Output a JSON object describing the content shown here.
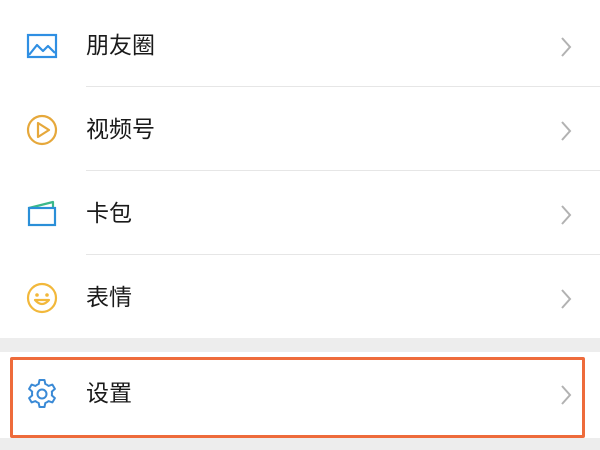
{
  "menu": {
    "items": [
      {
        "label": "朋友圈",
        "icon": "moments-picture-icon"
      },
      {
        "label": "视频号",
        "icon": "channels-play-icon"
      },
      {
        "label": "卡包",
        "icon": "card-wallet-icon"
      },
      {
        "label": "表情",
        "icon": "sticker-smiley-icon"
      }
    ],
    "settings": {
      "label": "设置",
      "icon": "settings-gear-icon",
      "highlighted": true
    }
  },
  "colors": {
    "moments_icon": "#2f8fe3",
    "channels_icon": "#e6a83b",
    "card_icon_blue": "#2a8fd8",
    "card_icon_green": "#3bb88a",
    "sticker_icon": "#f2b83b",
    "settings_icon": "#3a8ad6",
    "highlight_border": "#ee6b3b",
    "chevron": "#b2b2b2"
  }
}
